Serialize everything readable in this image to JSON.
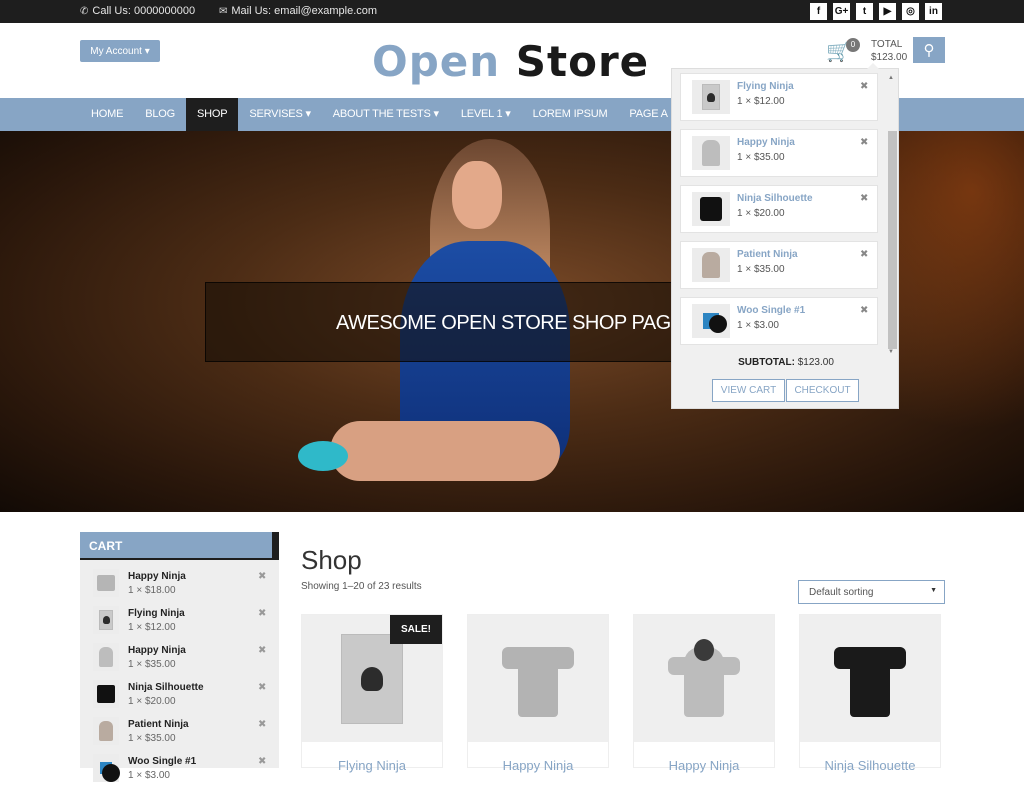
{
  "topbar": {
    "phone_icon": "phone-icon",
    "phone": "Call Us: 0000000000",
    "mail_icon": "envelope-icon",
    "mail": "Mail Us: email@example.com",
    "social": [
      {
        "name": "facebook",
        "glyph": "f"
      },
      {
        "name": "google-plus",
        "glyph": "G+"
      },
      {
        "name": "twitter",
        "glyph": "t"
      },
      {
        "name": "youtube",
        "glyph": "▶"
      },
      {
        "name": "instagram",
        "glyph": "◎"
      },
      {
        "name": "linkedin",
        "glyph": "in"
      }
    ]
  },
  "header": {
    "account_label": "My Account ▾",
    "logo_part1": "Open",
    "logo_part2": "Store",
    "cart_icon": "🛒",
    "cart_count": "0",
    "total_label": "TOTAL",
    "total_value": "$123.00",
    "search_icon": "⚲"
  },
  "nav": {
    "items": [
      {
        "label": "HOME"
      },
      {
        "label": "BLOG"
      },
      {
        "label": "SHOP",
        "active": true
      },
      {
        "label": "SERVISES ▾"
      },
      {
        "label": "ABOUT THE TESTS ▾"
      },
      {
        "label": "LEVEL 1 ▾"
      },
      {
        "label": "LOREM IPSUM"
      },
      {
        "label": "PAGE A"
      }
    ]
  },
  "hero": {
    "banner_text": "AWESOME OPEN STORE SHOP PAGE"
  },
  "mini_cart": {
    "items": [
      {
        "name": "Flying Ninja",
        "qty": "1 × $12.00",
        "remove": "✖",
        "thumb": "poster"
      },
      {
        "name": "Happy Ninja",
        "qty": "1 × $35.00",
        "remove": "✖",
        "thumb": "hoodie-gray"
      },
      {
        "name": "Ninja Silhouette",
        "qty": "1 × $20.00",
        "remove": "✖",
        "thumb": "tee-black"
      },
      {
        "name": "Patient Ninja",
        "qty": "1 × $35.00",
        "remove": "✖",
        "thumb": "hoodie-tan"
      },
      {
        "name": "Woo Single #1",
        "qty": "1 × $3.00",
        "remove": "✖",
        "thumb": "record"
      }
    ],
    "subtotal_label": "SUBTOTAL:",
    "subtotal_value": "$123.00",
    "view_cart": "VIEW CART",
    "checkout": "CHECKOUT"
  },
  "sidebar": {
    "title": "CART",
    "items": [
      {
        "name": "Happy Ninja",
        "qty": "1 × $18.00",
        "remove": "✖",
        "thumb": "tee-gray"
      },
      {
        "name": "Flying Ninja",
        "qty": "1 × $12.00",
        "remove": "✖",
        "thumb": "poster"
      },
      {
        "name": "Happy Ninja",
        "qty": "1 × $35.00",
        "remove": "✖",
        "thumb": "hoodie-gray"
      },
      {
        "name": "Ninja Silhouette",
        "qty": "1 × $20.00",
        "remove": "✖",
        "thumb": "tee-black"
      },
      {
        "name": "Patient Ninja",
        "qty": "1 × $35.00",
        "remove": "✖",
        "thumb": "hoodie-tan"
      },
      {
        "name": "Woo Single #1",
        "qty": "1 × $3.00",
        "remove": "✖",
        "thumb": "record"
      }
    ]
  },
  "shop": {
    "title": "Shop",
    "result_count": "Showing 1–20 of 23 results",
    "sort_selected": "Default sorting",
    "sort_arrow": "▼",
    "products": [
      {
        "name": "Flying Ninja",
        "badge": "SALE!",
        "thumb": "poster"
      },
      {
        "name": "Happy Ninja",
        "thumb": "tee-gray"
      },
      {
        "name": "Happy Ninja",
        "thumb": "hoodie-gray"
      },
      {
        "name": "Ninja Silhouette",
        "thumb": "tee-black"
      }
    ]
  },
  "colors": {
    "accent": "#87a5c5",
    "dark": "#1e1e1e"
  }
}
